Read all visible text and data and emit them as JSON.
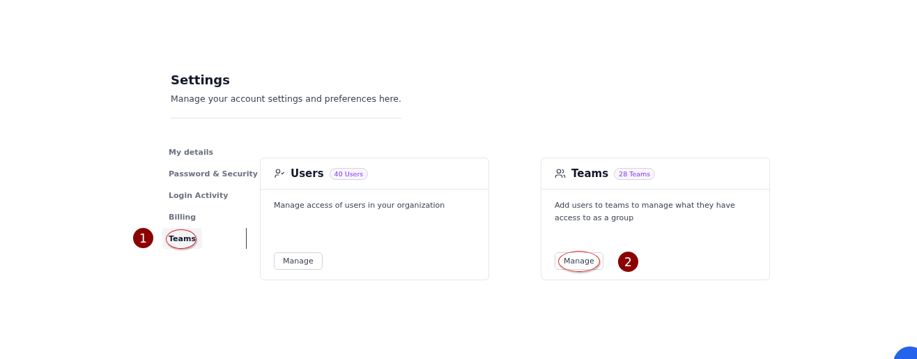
{
  "header": {
    "title": "Settings",
    "subtitle": "Manage your account settings and preferences here."
  },
  "nav": [
    {
      "label": "My details",
      "selected": false,
      "circled": false
    },
    {
      "label": "Password & Security",
      "selected": false,
      "circled": false
    },
    {
      "label": "Login Activity",
      "selected": false,
      "circled": false
    },
    {
      "label": "Billing",
      "selected": false,
      "circled": false
    },
    {
      "label": "Teams",
      "selected": true,
      "circled": true,
      "marker": "1"
    }
  ],
  "cards": [
    {
      "kind": "users",
      "title": "Users",
      "badge": "40 Users",
      "description": "Manage access of users in your organization",
      "button": {
        "label": "Manage",
        "circled": false
      }
    },
    {
      "kind": "teams",
      "title": "Teams",
      "badge": "28 Teams",
      "description": "Add users to teams to manage what they have access to as a group",
      "button": {
        "label": "Manage",
        "circled": true,
        "marker": "2"
      }
    }
  ]
}
